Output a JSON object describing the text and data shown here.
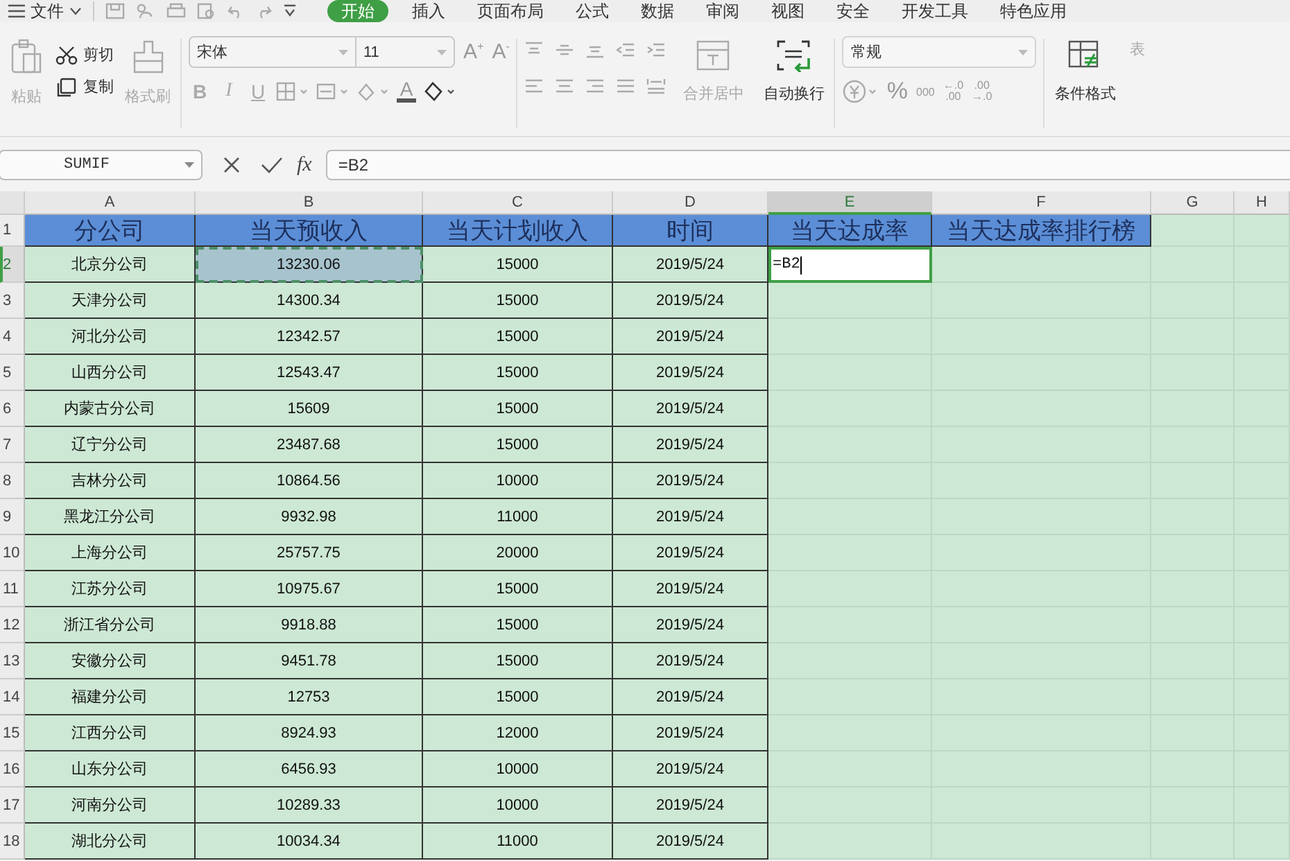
{
  "menu": {
    "file": "文件",
    "tabs": [
      {
        "label": "开始",
        "selected": true
      },
      {
        "label": "插入",
        "selected": false
      },
      {
        "label": "页面布局",
        "selected": false
      },
      {
        "label": "公式",
        "selected": false
      },
      {
        "label": "数据",
        "selected": false
      },
      {
        "label": "审阅",
        "selected": false
      },
      {
        "label": "视图",
        "selected": false
      },
      {
        "label": "安全",
        "selected": false
      },
      {
        "label": "开发工具",
        "selected": false
      },
      {
        "label": "特色应用",
        "selected": false
      }
    ]
  },
  "ribbon": {
    "clipboard": [
      {
        "kind": "paste",
        "label": "粘贴",
        "disabled": true
      },
      {
        "kind": "cut",
        "label": "剪切",
        "disabled": false
      },
      {
        "kind": "copy",
        "label": "复制",
        "disabled": false
      },
      {
        "kind": "painter",
        "label": "格式刷",
        "disabled": true
      }
    ],
    "font": {
      "name": "宋体",
      "size": "11",
      "grow": "A$^{+}$",
      "shrink": "A$^{-}$",
      "bold": "B",
      "italic": "I",
      "underline": "U",
      "font_color_button": "A"
    },
    "alignment": {
      "merge": {
        "label": "合并居中",
        "disabled": true
      },
      "wrap": {
        "label": "自动换行",
        "disabled": false
      }
    },
    "number": {
      "format": "常规",
      "percent": "%",
      "thousands": "000",
      "decimals": [
        {
          "top": "←.0",
          "bottom": ".00"
        },
        {
          "top": ".00",
          "bottom": "→.0"
        }
      ]
    },
    "styles": [
      {
        "label": "条件格式"
      },
      {
        "label": "表"
      }
    ]
  },
  "formula_bar": {
    "name_box": "SUMIF",
    "fx": "fx",
    "formula": "=B2"
  },
  "sheet": {
    "columns": [
      {
        "label": "A",
        "selected": false
      },
      {
        "label": "B",
        "selected": false
      },
      {
        "label": "C",
        "selected": false
      },
      {
        "label": "D",
        "selected": false
      },
      {
        "label": "E",
        "selected": true
      },
      {
        "label": "F",
        "selected": false
      },
      {
        "label": "G",
        "selected": false
      },
      {
        "label": "H",
        "selected": false
      }
    ],
    "header_row": {
      "number": "1",
      "selected": false,
      "cells": [
        "分公司",
        "当天预收入",
        "当天计划收入",
        "时间",
        "当天达成率",
        "当天达成率排行榜"
      ]
    },
    "active_cell": {
      "value": "=B2"
    },
    "rows": [
      {
        "number": "2",
        "selected": true,
        "cells": [
          {
            "text": "北京分公司",
            "marquee": false
          },
          {
            "text": "13230.06",
            "marquee": true
          },
          {
            "text": "15000",
            "marquee": false
          },
          {
            "text": "2019/5/24",
            "marquee": false
          }
        ]
      },
      {
        "number": "3",
        "selected": false,
        "cells": [
          {
            "text": "天津分公司",
            "marquee": false
          },
          {
            "text": "14300.34",
            "marquee": false
          },
          {
            "text": "15000",
            "marquee": false
          },
          {
            "text": "2019/5/24",
            "marquee": false
          }
        ]
      },
      {
        "number": "4",
        "selected": false,
        "cells": [
          {
            "text": "河北分公司",
            "marquee": false
          },
          {
            "text": "12342.57",
            "marquee": false
          },
          {
            "text": "15000",
            "marquee": false
          },
          {
            "text": "2019/5/24",
            "marquee": false
          }
        ]
      },
      {
        "number": "5",
        "selected": false,
        "cells": [
          {
            "text": "山西分公司",
            "marquee": false
          },
          {
            "text": "12543.47",
            "marquee": false
          },
          {
            "text": "15000",
            "marquee": false
          },
          {
            "text": "2019/5/24",
            "marquee": false
          }
        ]
      },
      {
        "number": "6",
        "selected": false,
        "cells": [
          {
            "text": "内蒙古分公司",
            "marquee": false
          },
          {
            "text": "15609",
            "marquee": false
          },
          {
            "text": "15000",
            "marquee": false
          },
          {
            "text": "2019/5/24",
            "marquee": false
          }
        ]
      },
      {
        "number": "7",
        "selected": false,
        "cells": [
          {
            "text": "辽宁分公司",
            "marquee": false
          },
          {
            "text": "23487.68",
            "marquee": false
          },
          {
            "text": "15000",
            "marquee": false
          },
          {
            "text": "2019/5/24",
            "marquee": false
          }
        ]
      },
      {
        "number": "8",
        "selected": false,
        "cells": [
          {
            "text": "吉林分公司",
            "marquee": false
          },
          {
            "text": "10864.56",
            "marquee": false
          },
          {
            "text": "10000",
            "marquee": false
          },
          {
            "text": "2019/5/24",
            "marquee": false
          }
        ]
      },
      {
        "number": "9",
        "selected": false,
        "cells": [
          {
            "text": "黑龙江分公司",
            "marquee": false
          },
          {
            "text": "9932.98",
            "marquee": false
          },
          {
            "text": "11000",
            "marquee": false
          },
          {
            "text": "2019/5/24",
            "marquee": false
          }
        ]
      },
      {
        "number": "10",
        "selected": false,
        "cells": [
          {
            "text": "上海分公司",
            "marquee": false
          },
          {
            "text": "25757.75",
            "marquee": false
          },
          {
            "text": "20000",
            "marquee": false
          },
          {
            "text": "2019/5/24",
            "marquee": false
          }
        ]
      },
      {
        "number": "11",
        "selected": false,
        "cells": [
          {
            "text": "江苏分公司",
            "marquee": false
          },
          {
            "text": "10975.67",
            "marquee": false
          },
          {
            "text": "15000",
            "marquee": false
          },
          {
            "text": "2019/5/24",
            "marquee": false
          }
        ]
      },
      {
        "number": "12",
        "selected": false,
        "cells": [
          {
            "text": "浙江省分公司",
            "marquee": false
          },
          {
            "text": "9918.88",
            "marquee": false
          },
          {
            "text": "15000",
            "marquee": false
          },
          {
            "text": "2019/5/24",
            "marquee": false
          }
        ]
      },
      {
        "number": "13",
        "selected": false,
        "cells": [
          {
            "text": "安徽分公司",
            "marquee": false
          },
          {
            "text": "9451.78",
            "marquee": false
          },
          {
            "text": "15000",
            "marquee": false
          },
          {
            "text": "2019/5/24",
            "marquee": false
          }
        ]
      },
      {
        "number": "14",
        "selected": false,
        "cells": [
          {
            "text": "福建分公司",
            "marquee": false
          },
          {
            "text": "12753",
            "marquee": false
          },
          {
            "text": "15000",
            "marquee": false
          },
          {
            "text": "2019/5/24",
            "marquee": false
          }
        ]
      },
      {
        "number": "15",
        "selected": false,
        "cells": [
          {
            "text": "江西分公司",
            "marquee": false
          },
          {
            "text": "8924.93",
            "marquee": false
          },
          {
            "text": "12000",
            "marquee": false
          },
          {
            "text": "2019/5/24",
            "marquee": false
          }
        ]
      },
      {
        "number": "16",
        "selected": false,
        "cells": [
          {
            "text": "山东分公司",
            "marquee": false
          },
          {
            "text": "6456.93",
            "marquee": false
          },
          {
            "text": "10000",
            "marquee": false
          },
          {
            "text": "2019/5/24",
            "marquee": false
          }
        ]
      },
      {
        "number": "17",
        "selected": false,
        "cells": [
          {
            "text": "河南分公司",
            "marquee": false
          },
          {
            "text": "10289.33",
            "marquee": false
          },
          {
            "text": "10000",
            "marquee": false
          },
          {
            "text": "2019/5/24",
            "marquee": false
          }
        ]
      },
      {
        "number": "18",
        "selected": false,
        "cells": [
          {
            "text": "湖北分公司",
            "marquee": false
          },
          {
            "text": "10034.34",
            "marquee": false
          },
          {
            "text": "11000",
            "marquee": false
          },
          {
            "text": "2019/5/24",
            "marquee": false
          }
        ]
      }
    ]
  }
}
